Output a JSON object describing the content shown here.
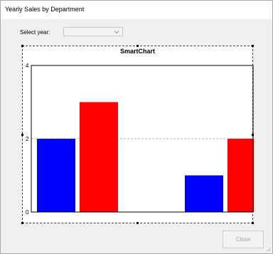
{
  "window": {
    "title": "Yearly Sales by Department"
  },
  "filter": {
    "label": "Select year:",
    "selected": ""
  },
  "chart_data": {
    "type": "bar",
    "title": "SmartChart",
    "categories": [
      "",
      "",
      ""
    ],
    "series": [
      {
        "values": [
          2,
          null,
          1
        ],
        "color": "#0000ff"
      },
      {
        "values": [
          3,
          null,
          2
        ],
        "color": "#ff0000"
      }
    ],
    "ylim": [
      0,
      4
    ],
    "yticks": [
      "0",
      "2",
      "4"
    ],
    "grid": "dashed horizontal at 2"
  },
  "footer": {
    "close_label": "Close"
  },
  "icons": {
    "dropdown": "chevron-down-icon",
    "resize": "resize-grip-icon"
  }
}
